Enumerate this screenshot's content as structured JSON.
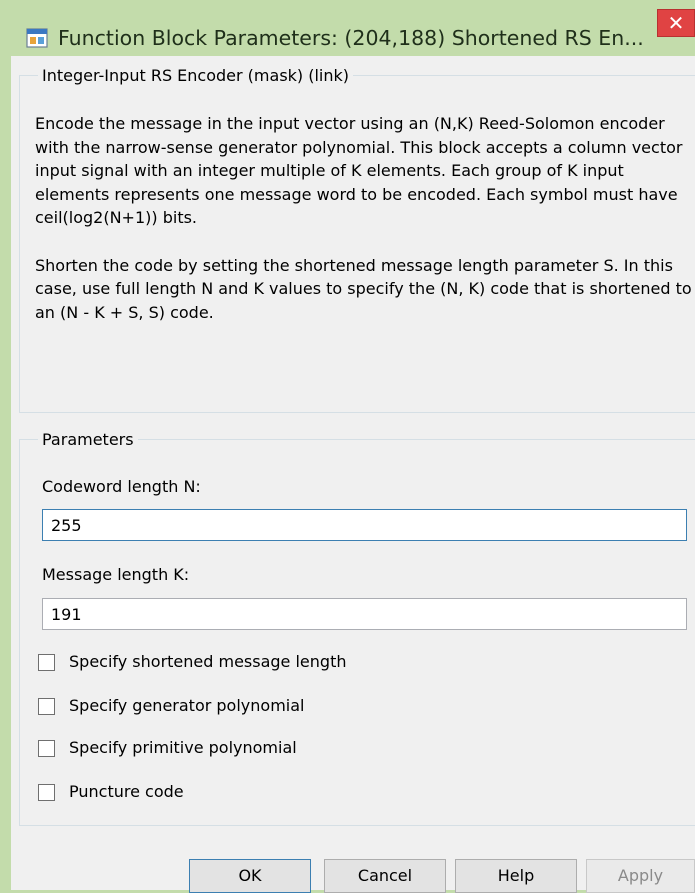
{
  "window": {
    "title": "Function Block Parameters: (204,188) Shortened RS En...",
    "close_symbol": "✕",
    "icon": "simulink-block-icon"
  },
  "mask": {
    "legend": "Integer-Input RS Encoder (mask) (link)",
    "paragraph1": "Encode the message in the input vector using an (N,K) Reed-Solomon encoder with the narrow-sense generator polynomial.  This block accepts a column vector input signal with an integer multiple of K elements.  Each group of K input elements represents one message word to be encoded.  Each symbol must have ceil(log2(N+1)) bits.",
    "paragraph2": "Shorten the code by setting the shortened message length parameter S. In this case, use full length N and K values to specify the (N, K) code that is shortened to an (N - K + S, S) code."
  },
  "parameters": {
    "legend": "Parameters",
    "codeword": {
      "label": "Codeword length N:",
      "value": "255"
    },
    "message": {
      "label": "Message length K:",
      "value": "191"
    },
    "checkboxes": [
      {
        "label": "Specify shortened message length",
        "checked": false
      },
      {
        "label": "Specify generator polynomial",
        "checked": false
      },
      {
        "label": "Specify primitive polynomial",
        "checked": false
      },
      {
        "label": "Puncture code",
        "checked": false
      }
    ]
  },
  "buttons": {
    "ok": "OK",
    "cancel": "Cancel",
    "help": "Help",
    "apply": "Apply"
  },
  "colors": {
    "frame": "#c3dcab",
    "close": "#e04343",
    "focus_border": "#3c7fb1"
  }
}
